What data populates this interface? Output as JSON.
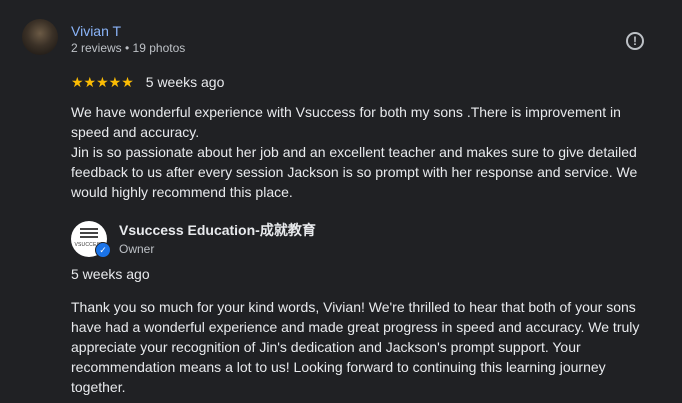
{
  "review": {
    "reviewer_name": "Vivian T",
    "reviewer_meta": "2 reviews • 19 photos",
    "rating": 5,
    "stars": "★★★★★",
    "date": "5 weeks ago",
    "paragraphs": [
      "We have wonderful experience with Vsuccess for both my sons .There is improvement in speed and accuracy.",
      "Jin is so passionate about her job and an excellent teacher and makes sure to give detailed feedback to us after every session Jackson is so prompt with her response and service. We would highly recommend this place."
    ],
    "more_icon": "info-circle-icon"
  },
  "owner_reply": {
    "name": "Vsuccess Education-成就教育",
    "role": "Owner",
    "logo_text": "VSUCCESS",
    "date": "5 weeks ago",
    "text": "Thank you so much for your kind words, Vivian! We're thrilled to hear that both of your sons have had a wonderful experience and made great progress in speed and accuracy. We truly appreciate your recognition of Jin's dedication and Jackson's prompt support. Your recommendation means a lot to us! Looking forward to continuing this learning journey together."
  },
  "colors": {
    "background": "#202124",
    "link": "#8ab4f8",
    "star": "#fbbc04",
    "verified": "#1a73e8"
  }
}
